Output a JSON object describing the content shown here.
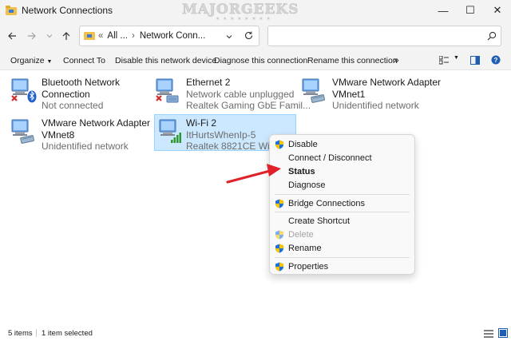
{
  "window": {
    "title": "Network Connections",
    "watermark": "MAJORGEEKS",
    "watermark_sub": "★ ★ ★ ★ ★ ★ ★ ★",
    "minimize_glyph": "—",
    "maximize_glyph": "☐",
    "close_glyph": "✕"
  },
  "address": {
    "ellipsis": "All ...",
    "separator": "›",
    "current": "Network Conn...",
    "search_placeholder": ""
  },
  "toolbar": {
    "organize": "Organize",
    "connect_to": "Connect To",
    "disable_device": "Disable this network device",
    "diagnose_connection": "Diagnose this connection",
    "rename_connection": "Rename this connection",
    "more": "»"
  },
  "connections": [
    {
      "name": "Bluetooth Network",
      "name2": "Connection",
      "status": "Not connected",
      "device": "",
      "icon": "bluetooth-adapter-icon",
      "state": "disconnected"
    },
    {
      "name": "Ethernet 2",
      "name2": "",
      "status": "Network cable unplugged",
      "device": "Realtek Gaming GbE Famil...",
      "icon": "ethernet-adapter-icon",
      "state": "disconnected"
    },
    {
      "name": "VMware Network Adapter",
      "name2": "VMnet1",
      "status": "Unidentified network",
      "device": "",
      "icon": "vmware-adapter-icon",
      "state": "connected"
    },
    {
      "name": "VMware Network Adapter",
      "name2": "VMnet8",
      "status": "Unidentified network",
      "device": "",
      "icon": "vmware-adapter-icon",
      "state": "connected"
    },
    {
      "name": "Wi-Fi 2",
      "name2": "",
      "status": "ItHurtsWhenIp-5",
      "device": "Realtek 8821CE Wirele",
      "icon": "wifi-adapter-icon",
      "state": "selected"
    }
  ],
  "context_menu": [
    {
      "label": "Disable",
      "shield": true,
      "bold": false,
      "disabled": false
    },
    {
      "label": "Connect / Disconnect",
      "shield": false,
      "bold": false,
      "disabled": false
    },
    {
      "label": "Status",
      "shield": false,
      "bold": true,
      "disabled": false
    },
    {
      "label": "Diagnose",
      "shield": false,
      "bold": false,
      "disabled": false
    },
    {
      "label": "Bridge Connections",
      "shield": true,
      "bold": false,
      "disabled": false
    },
    {
      "label": "Create Shortcut",
      "shield": false,
      "bold": false,
      "disabled": false
    },
    {
      "label": "Delete",
      "shield": true,
      "bold": false,
      "disabled": true
    },
    {
      "label": "Rename",
      "shield": true,
      "bold": false,
      "disabled": false
    },
    {
      "label": "Properties",
      "shield": true,
      "bold": false,
      "disabled": false
    }
  ],
  "statusbar": {
    "items_count": "5 items",
    "selection": "1 item selected"
  },
  "colors": {
    "selection_bg": "#cce8ff",
    "arrow": "#e0202a",
    "shield_blue": "#1e6fd9",
    "shield_yellow": "#f5c400"
  }
}
